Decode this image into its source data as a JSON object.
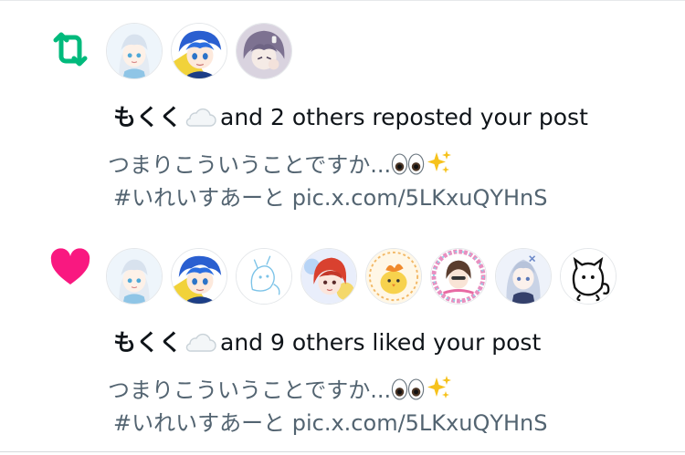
{
  "notifications": [
    {
      "type": "repost",
      "icon": "repost-icon",
      "icon_color": "#00ba7c",
      "avatars": [
        "avatar-white-hair-girl",
        "avatar-blue-hair-boy",
        "avatar-purple-hair-girl"
      ],
      "actor_name": "もくく",
      "actor_emoji": "cloud",
      "action_text": "and 2 others reposted your post",
      "post_line1": "つまりこういうことですか...",
      "post_line1_emojis": [
        "eyes",
        "sparkles"
      ],
      "post_hashtag": "#いれいすあーと",
      "post_link": "pic.x.com/5LKxuQYHnS"
    },
    {
      "type": "like",
      "icon": "heart-icon",
      "icon_color": "#f91880",
      "avatars": [
        "avatar-white-hair-girl",
        "avatar-blue-hair-boy",
        "avatar-sketch-creature",
        "avatar-red-hair-character",
        "avatar-yellow-chick",
        "avatar-summer-tour-character",
        "avatar-silver-hair-girl",
        "avatar-black-cat-sketch"
      ],
      "actor_name": "もくく",
      "actor_emoji": "cloud",
      "action_text": "and 9 others liked your post",
      "post_line1": "つまりこういうことですか...",
      "post_line1_emojis": [
        "eyes",
        "sparkles"
      ],
      "post_hashtag": "#いれいすあーと",
      "post_link": "pic.x.com/5LKxuQYHnS"
    }
  ]
}
